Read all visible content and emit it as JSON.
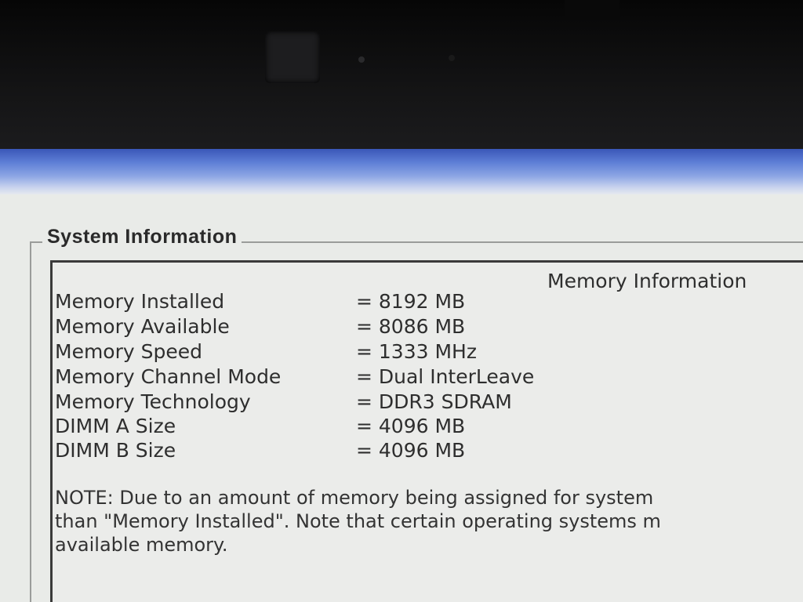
{
  "window": {
    "group_title": "System Information",
    "section_title": "Memory Information"
  },
  "memory_rows": [
    {
      "label": "Memory Installed",
      "value": "= 8192 MB"
    },
    {
      "label": "Memory Available",
      "value": "= 8086 MB"
    },
    {
      "label": "Memory Speed",
      "value": "= 1333 MHz"
    },
    {
      "label": "Memory Channel Mode",
      "value": "= Dual InterLeave"
    },
    {
      "label": "Memory Technology",
      "value": "= DDR3 SDRAM"
    },
    {
      "label": "DIMM A Size",
      "value": "= 4096 MB"
    },
    {
      "label": "DIMM B Size",
      "value": "= 4096 MB"
    }
  ],
  "note": {
    "line1": "NOTE: Due to an amount of memory being assigned for system",
    "line2": "than \"Memory Installed\". Note that certain operating systems m",
    "line3": "available memory."
  }
}
